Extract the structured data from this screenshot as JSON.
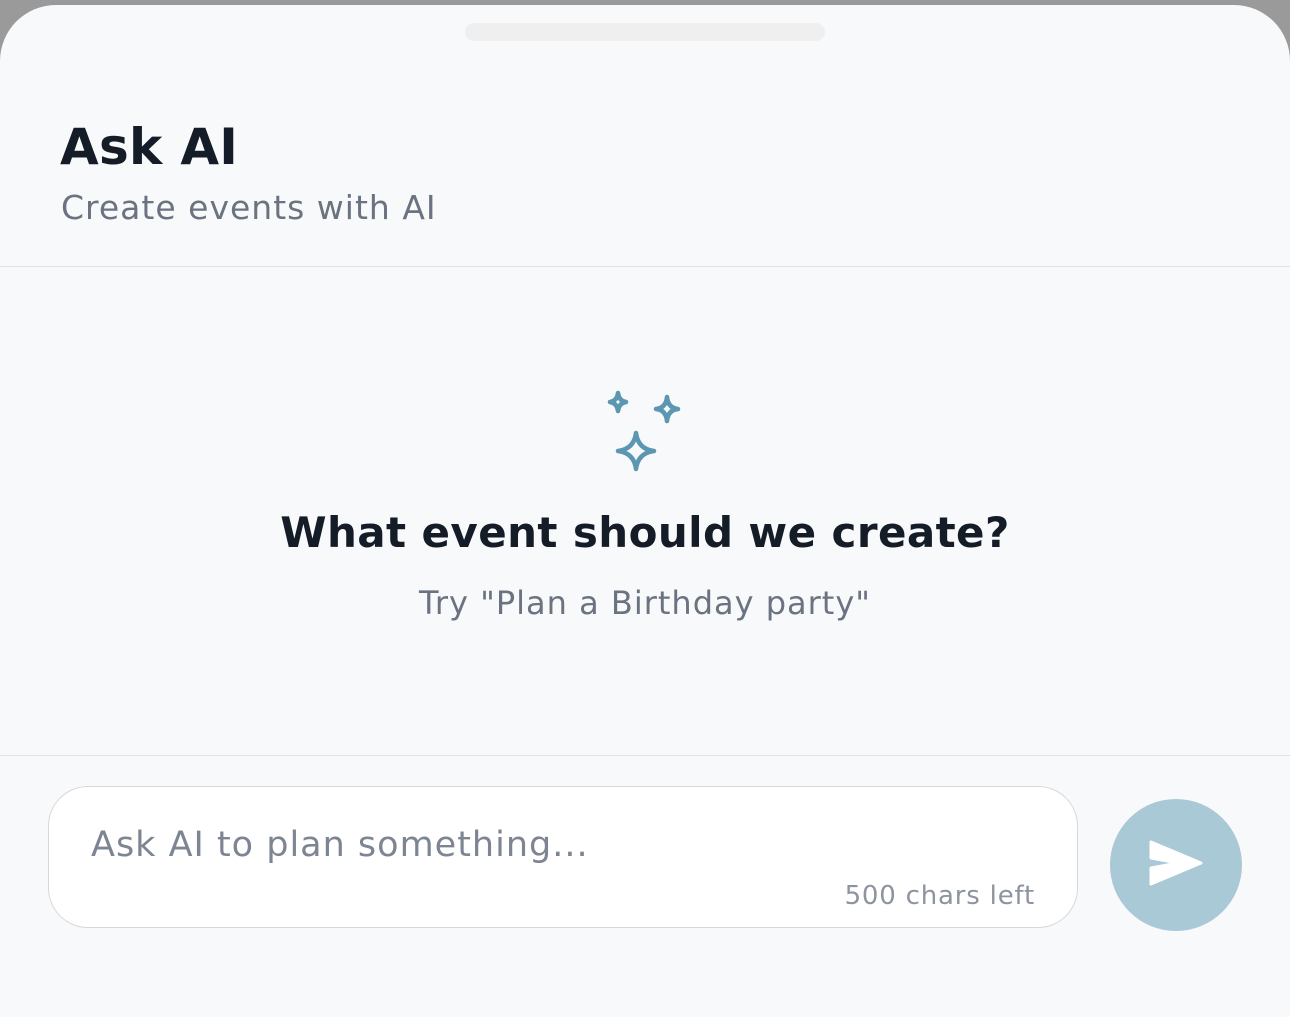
{
  "header": {
    "title": "Ask AI",
    "subtitle": "Create events with AI"
  },
  "empty_state": {
    "icon": "sparkles-icon",
    "title": "What event should we create?",
    "hint": "Try \"Plan a Birthday party\""
  },
  "composer": {
    "value": "",
    "placeholder": "Ask AI to plan something...",
    "chars_left": "500 chars left"
  },
  "send": {
    "icon": "send-icon"
  },
  "colors": {
    "accent": "#5b97b0",
    "send_button": "#a9c9d6",
    "title_text": "#141c28",
    "muted_text": "#6b7381",
    "background": "#f8f9fb"
  }
}
